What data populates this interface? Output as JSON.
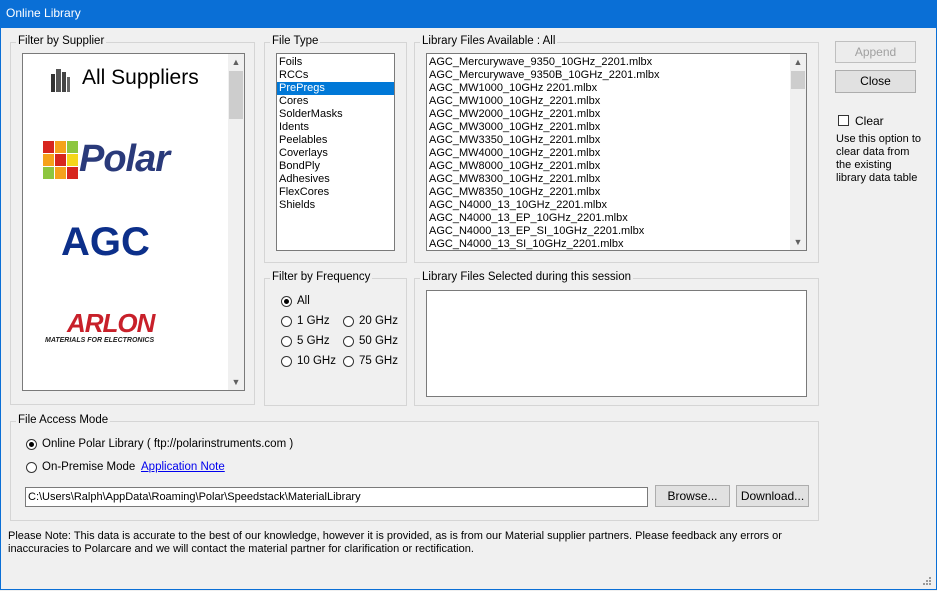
{
  "window": {
    "title": "Online Library"
  },
  "supplier_filter": {
    "legend": "Filter by Supplier",
    "all_label": "All Suppliers",
    "polar_label": "Polar",
    "agc_label": "AGC",
    "arlon_label": "ARLON",
    "arlon_tagline": "MATERIALS FOR ELECTRONICS"
  },
  "file_type": {
    "legend": "File Type",
    "items": [
      "Foils",
      "RCCs",
      "PrePregs",
      "Cores",
      "SolderMasks",
      "Idents",
      "Peelables",
      "Coverlays",
      "BondPly",
      "Adhesives",
      "FlexCores",
      "Shields"
    ],
    "selected": "PrePregs"
  },
  "library_files": {
    "legend": "Library Files Available : All",
    "items": [
      "AGC_Mercurywave_9350_10GHz_2201.mlbx",
      "AGC_Mercurywave_9350B_10GHz_2201.mlbx",
      "AGC_MW1000_10GHz 2201.mlbx",
      "AGC_MW1000_10GHz_2201.mlbx",
      "AGC_MW2000_10GHz_2201.mlbx",
      "AGC_MW3000_10GHz_2201.mlbx",
      "AGC_MW3350_10GHz_2201.mlbx",
      "AGC_MW4000_10GHz_2201.mlbx",
      "AGC_MW8000_10GHz_2201.mlbx",
      "AGC_MW8300_10GHz_2201.mlbx",
      "AGC_MW8350_10GHz_2201.mlbx",
      "AGC_N4000_13_10GHz_2201.mlbx",
      "AGC_N4000_13_EP_10GHz_2201.mlbx",
      "AGC_N4000_13_EP_SI_10GHz_2201.mlbx",
      "AGC_N4000_13_SI_10GHz_2201.mlbx"
    ]
  },
  "frequency": {
    "legend": "Filter by Frequency",
    "options": [
      "All",
      "1 GHz",
      "20 GHz",
      "5 GHz",
      "50 GHz",
      "10 GHz",
      "75 GHz"
    ],
    "selected": "All"
  },
  "selected_files": {
    "legend": "Library Files Selected during this session"
  },
  "buttons": {
    "append": "Append",
    "close": "Close",
    "browse": "Browse...",
    "download": "Download..."
  },
  "clear": {
    "label": "Clear",
    "help": [
      "Use this option to",
      "clear data from",
      "the existing",
      "library data table"
    ]
  },
  "file_access": {
    "legend": "File Access Mode",
    "online_label": "Online Polar Library ( ftp://polarinstruments.com )",
    "onprem_label": "On-Premise Mode",
    "app_note": "Application Note",
    "path": "C:\\Users\\Ralph\\AppData\\Roaming\\Polar\\Speedstack\\MaterialLibrary",
    "selected": "online"
  },
  "note": {
    "line1": "Please Note:  This data is accurate to the best of our knowledge, however it is provided, as is from our Material supplier partners.  Please feedback any errors or",
    "line2": "inaccuracies to Polarcare and we will contact the material partner for clarification or rectification."
  },
  "colors": {
    "title_bar": "#0a6fd6",
    "selection": "#0078d7",
    "polar_blue": "#2a3a7a",
    "agc_blue": "#0c2f8a",
    "arlon_red": "#c8202a"
  }
}
